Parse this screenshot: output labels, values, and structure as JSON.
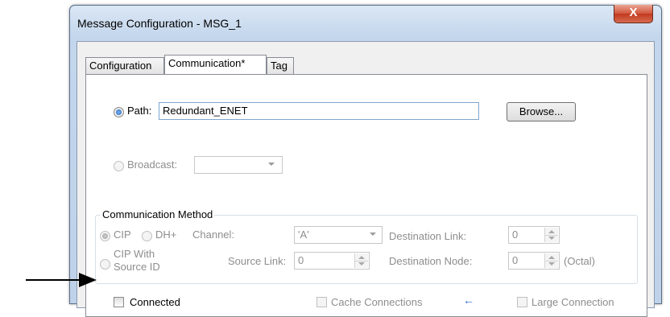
{
  "window": {
    "title": "Message Configuration - MSG_1",
    "close_glyph": "X"
  },
  "tabs": [
    {
      "label": "Configuration",
      "active": false
    },
    {
      "label": "Communication*",
      "active": true
    },
    {
      "label": "Tag",
      "active": false
    }
  ],
  "path": {
    "label": "Path:",
    "value": "Redundant_ENET",
    "selected": true,
    "browse_label": "Browse..."
  },
  "broadcast": {
    "label": "Broadcast:",
    "value": "",
    "enabled": false
  },
  "comm_method": {
    "title": "Communication Method",
    "cip_label": "CIP",
    "dhplus_label": "DH+",
    "cip_source_line1": "CIP With",
    "cip_source_line2": "Source ID",
    "channel_label": "Channel:",
    "channel_value": "'A'",
    "destination_link_label": "Destination Link:",
    "destination_link_value": "0",
    "source_link_label": "Source Link:",
    "source_link_value": "0",
    "destination_node_label": "Destination Node:",
    "destination_node_value": "0",
    "octal_label": "(Octal)"
  },
  "options": {
    "connected_label": "Connected",
    "connected_checked": false,
    "cache_label": "Cache Connections",
    "cache_arrow": "←",
    "large_label": "Large Connection"
  },
  "colors": {
    "accent_blue": "#1c5fb5",
    "close_red": "#c23a20",
    "disabled_text": "#8d8d8d"
  }
}
